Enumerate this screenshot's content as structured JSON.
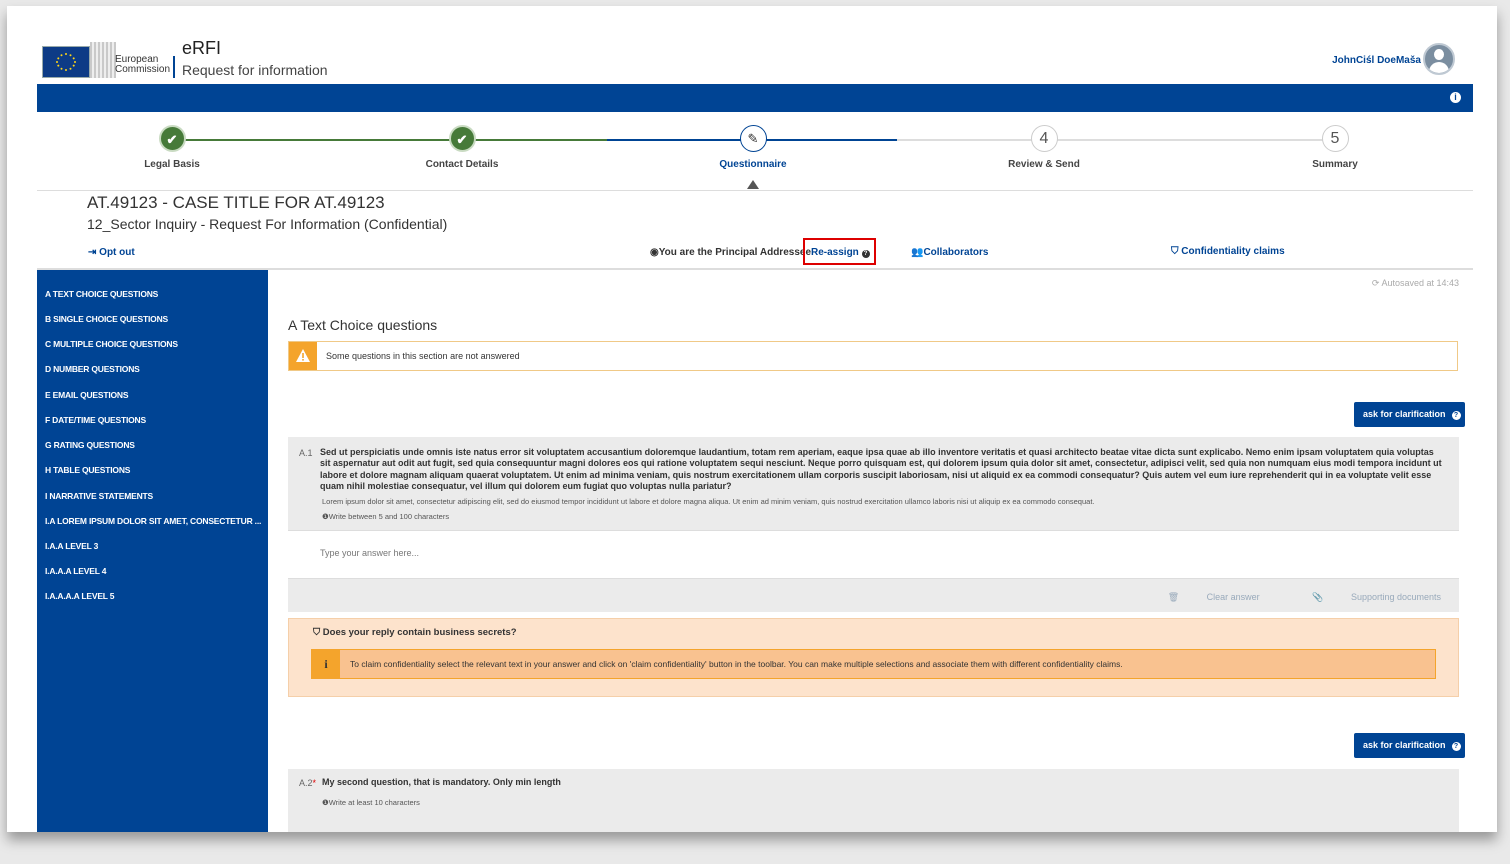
{
  "header": {
    "org_line1": "European",
    "org_line2": "Commission",
    "app_title": "eRFI",
    "app_subtitle": "Request for information",
    "user_name": "JohnCiśl DoeMaša"
  },
  "steps": [
    {
      "label": "Legal Basis",
      "state": "done",
      "icon": "check-icon"
    },
    {
      "label": "Contact Details",
      "state": "done",
      "icon": "check-icon"
    },
    {
      "label": "Questionnaire",
      "state": "active",
      "icon": "pencil-icon"
    },
    {
      "label": "Review & Send",
      "state": "todo",
      "number": "4"
    },
    {
      "label": "Summary",
      "state": "todo",
      "number": "5"
    }
  ],
  "case": {
    "title": "AT.49123 - CASE TITLE FOR AT.49123",
    "subtitle": "12_Sector Inquiry - Request For Information (Confidential)"
  },
  "toolbar": {
    "opt_out": "Opt out",
    "principal": "You are the Principal Addressee",
    "reassign": "Re-assign",
    "collaborators": "Collaborators",
    "confidentiality_claims": "Confidentiality claims"
  },
  "sidebar": {
    "items": [
      "A TEXT CHOICE QUESTIONS",
      "B SINGLE CHOICE QUESTIONS",
      "C MULTIPLE CHOICE QUESTIONS",
      "D NUMBER QUESTIONS",
      "E EMAIL QUESTIONS",
      "F DATE/TIME QUESTIONS",
      "G RATING QUESTIONS",
      "H TABLE QUESTIONS",
      "I NARRATIVE STATEMENTS",
      "I.A LOREM IPSUM DOLOR SIT AMET, CONSECTETUR ...",
      "I.A.A LEVEL 3",
      "I.A.A.A LEVEL 4",
      "I.A.A.A.A LEVEL 5"
    ]
  },
  "main": {
    "autosaved": "Autosaved at 14:43",
    "section_title": "A Text Choice questions",
    "warning": "Some questions in this section are not answered",
    "ask_label": "ask for clarification",
    "q1": {
      "number": "A.1",
      "text": "Sed ut perspiciatis unde omnis iste natus error sit voluptatem accusantium doloremque laudantium, totam rem aperiam, eaque ipsa quae ab illo inventore veritatis et quasi architecto beatae vitae dicta sunt explicabo. Nemo enim ipsam voluptatem quia voluptas sit aspernatur aut odit aut fugit, sed quia consequuntur magni dolores eos qui ratione voluptatem sequi nesciunt. Neque porro quisquam est, qui dolorem ipsum quia dolor sit amet, consectetur, adipisci velit, sed quia non numquam eius modi tempora incidunt ut labore et dolore magnam aliquam quaerat voluptatem. Ut enim ad minima veniam, quis nostrum exercitationem ullam corporis suscipit laboriosam, nisi ut aliquid ex ea commodi consequatur? Quis autem vel eum iure reprehenderit qui in ea voluptate velit esse quam nihil molestiae consequatur, vel illum qui dolorem eum fugiat quo voluptas nulla pariatur?",
      "description": "Lorem ipsum dolor sit amet, consectetur adipiscing elit, sed do eiusmod tempor incididunt ut labore et dolore magna aliqua. Ut enim ad minim veniam, quis nostrud exercitation ullamco laboris nisi ut aliquip ex ea commodo consequat.",
      "hint": "Write between 5 and 100 characters",
      "placeholder": "Type your answer here...",
      "clear_answer": "Clear answer",
      "supporting_documents": "Supporting documents"
    },
    "secrets": {
      "question": "Does your reply contain business secrets?",
      "info": "To claim confidentiality select the relevant text in your answer and click on 'claim confidentiality' button in the toolbar. You can make multiple selections and associate them with different confidentiality claims."
    },
    "q2": {
      "number": "A.2",
      "required_mark": "*",
      "text": "My second question, that is mandatory. Only min length",
      "hint": "Write at least 10 characters"
    }
  },
  "colors": {
    "primary": "#004494",
    "done": "#467a39",
    "warning": "#f4a42c",
    "highlight_border": "#dd0000"
  }
}
